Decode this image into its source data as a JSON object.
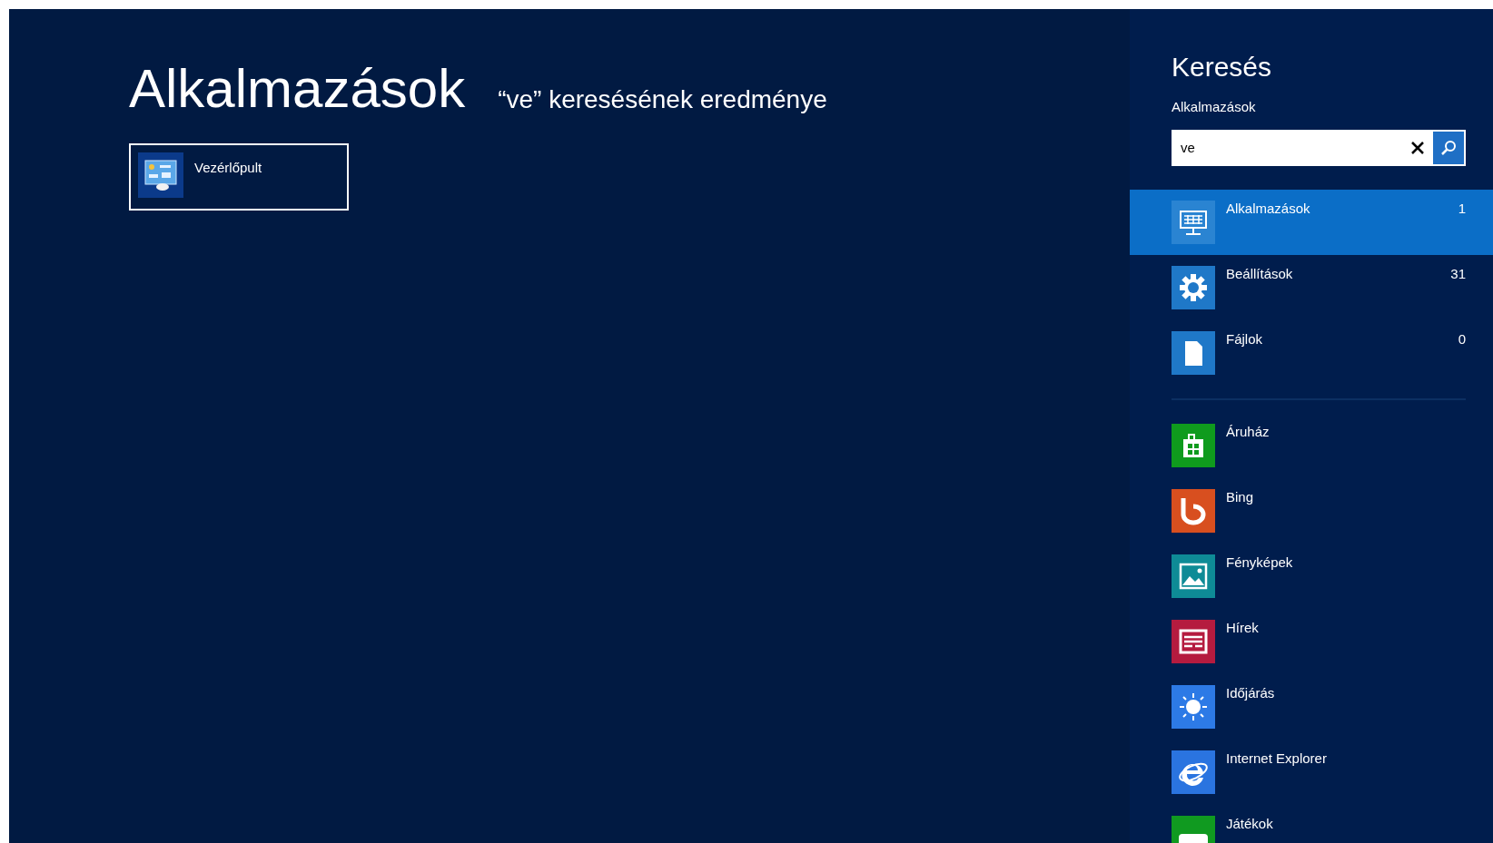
{
  "results": {
    "title": "Alkalmazások",
    "subtitle": "“ve” keresésének eredménye",
    "tiles": [
      {
        "label": "Vezérlőpult",
        "selected": true
      }
    ]
  },
  "search_pane": {
    "title": "Keresés",
    "scope_label": "Alkalmazások",
    "search": {
      "value": "ve"
    },
    "scopes": [
      {
        "label": "Alkalmazások",
        "count": "1",
        "selected": true
      },
      {
        "label": "Beállítások",
        "count": "31",
        "selected": false
      },
      {
        "label": "Fájlok",
        "count": "0",
        "selected": false
      }
    ],
    "apps": [
      {
        "label": "Áruház",
        "color": "#0f9b1d"
      },
      {
        "label": "Bing",
        "color": "#d84f1f"
      },
      {
        "label": "Fényképek",
        "color": "#0e8b96"
      },
      {
        "label": "Hírek",
        "color": "#b51b3f"
      },
      {
        "label": "Időjárás",
        "color": "#2d7ae6"
      },
      {
        "label": "Internet Explorer",
        "color": "#2a74e0"
      },
      {
        "label": "Játékok",
        "color": "#109a20"
      }
    ]
  }
}
